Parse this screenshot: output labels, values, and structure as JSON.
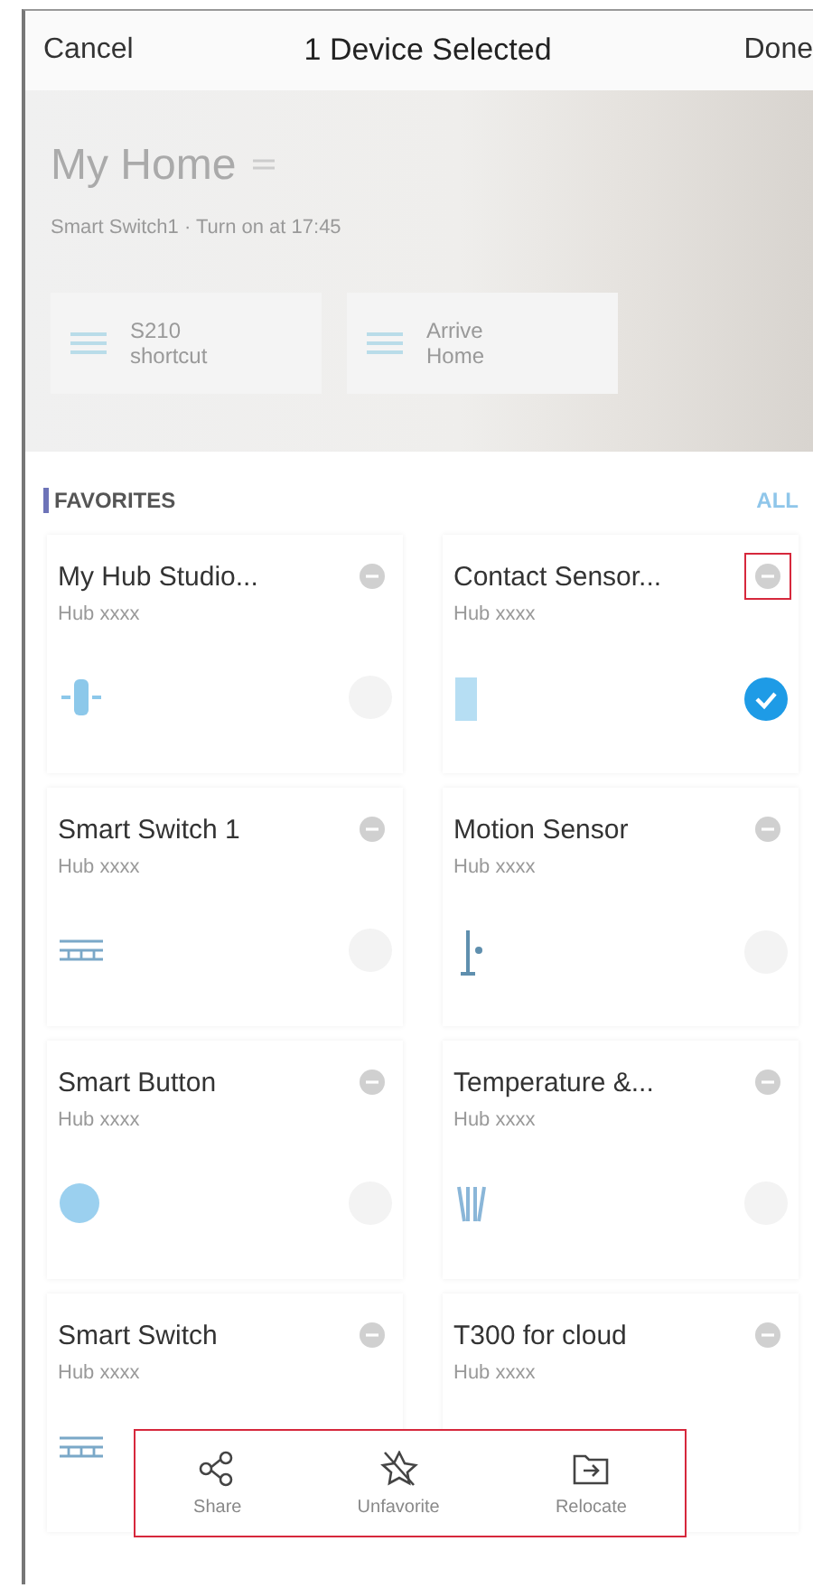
{
  "nav": {
    "cancel": "Cancel",
    "title": "1 Device Selected",
    "done": "Done"
  },
  "home": {
    "name": "My Home",
    "subtitle": "Smart Switch1 · Turn on at 17:45",
    "shortcuts": [
      {
        "line1": "S210",
        "line2": "shortcut"
      },
      {
        "line1": "Arrive",
        "line2": "Home"
      }
    ]
  },
  "favorites": {
    "title": "FAVORITES",
    "all": "ALL"
  },
  "devices": [
    {
      "name": "My Hub Studio...",
      "subtitle": "Hub xxxx",
      "kind": "hub",
      "selected": false,
      "highlighted": false
    },
    {
      "name": "Contact Sensor...",
      "subtitle": "Hub xxxx",
      "kind": "contact",
      "selected": true,
      "highlighted": true
    },
    {
      "name": "Smart Switch 1",
      "subtitle": "Hub xxxx",
      "kind": "switch",
      "selected": false,
      "highlighted": false
    },
    {
      "name": "Motion Sensor",
      "subtitle": "Hub xxxx",
      "kind": "motion",
      "selected": false,
      "highlighted": false
    },
    {
      "name": "Smart Button",
      "subtitle": "Hub xxxx",
      "kind": "button",
      "selected": false,
      "highlighted": false
    },
    {
      "name": "Temperature &...",
      "subtitle": "Hub xxxx",
      "kind": "temperature",
      "selected": false,
      "highlighted": false
    },
    {
      "name": "Smart Switch",
      "subtitle": "Hub xxxx",
      "kind": "switch",
      "highlighted": false
    },
    {
      "name": "T300 for cloud",
      "subtitle": "Hub xxxx",
      "kind": "other",
      "highlighted": false
    }
  ],
  "actions": {
    "highlighted": true,
    "items": [
      {
        "label": "Share",
        "kind": "share"
      },
      {
        "label": "Unfavorite",
        "kind": "unfavorite"
      },
      {
        "label": "Relocate",
        "kind": "relocate"
      }
    ]
  }
}
